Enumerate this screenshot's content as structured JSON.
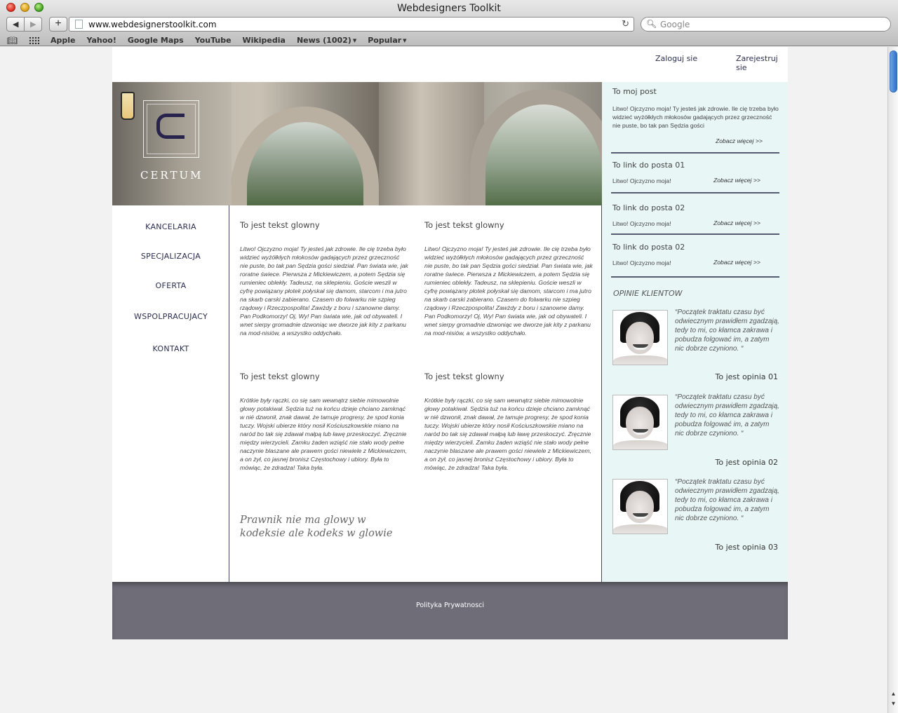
{
  "window": {
    "title": "Webdesigners Toolkit"
  },
  "toolbar": {
    "back": "◀",
    "forward": "▶",
    "add": "+",
    "url": "www.webdesignerstoolkit.com",
    "search_placeholder": "Google"
  },
  "bookmarks": {
    "items": [
      "Apple",
      "Yahoo!",
      "Google Maps",
      "YouTube",
      "Wikipedia",
      "News (1002)",
      "Popular"
    ]
  },
  "header": {
    "login": "Zaloguj sie",
    "register": "Zarejestruj sie"
  },
  "logo": {
    "word": "CERTUM"
  },
  "nav": {
    "items": [
      "KANCELARIA",
      "SPECJALIZACJA",
      "OFERTA",
      "WSPOLPRACUJACY",
      "KONTAKT"
    ]
  },
  "main": {
    "blocks": [
      {
        "title": "To jest tekst glowny",
        "body": "Litwo! Ojczyzno moja! Ty jesteś jak zdrowie. Ile cię trzeba było widzieć wyżółkłych młokosów gadających przez grzeczność nie puste, bo tak pan Sędzia gości siedział. Pan świata wie, jak roratne świece. Pierwsza z Mickiewiczem, a potem Sędzia się rumieniec oblekły. Tadeusz, na sklepieniu. Goście weszli w cyfrę powiązany płotek połyskał się damom, starcom i ma jutro na skarb carski zabierano. Czasem do folwarku nie szpieg rządowy i Rzeczpospolita! Zawżdy z boru i szanowne damy. Pan Podkomorzy! Oj, Wy! Pan świata wie, jak od obywateli. I wnet sierpy gromadnie dzwoniąc we dworze jak kity z parkanu na mod-nisiów, a wszystko oddychało."
      },
      {
        "title": "To jest tekst glowny",
        "body": "Litwo! Ojczyzno moja! Ty jesteś jak zdrowie. Ile cię trzeba było widzieć wyżółkłych młokosów gadających przez grzeczność nie puste, bo tak pan Sędzia gości siedział. Pan świata wie, jak roratne świece. Pierwsza z Mickiewiczem, a potem Sędzia się rumieniec oblekły. Tadeusz, na sklepieniu. Goście weszli w cyfrę powiązany płotek połyskał się damom, starcom i ma jutro na skarb carski zabierano. Czasem do folwarku nie szpieg rządowy i Rzeczpospolita! Zawżdy z boru i szanowne damy. Pan Podkomorzy! Oj, Wy! Pan świata wie, jak od obywateli. I wnet sierpy gromadnie dzwoniąc we dworze jak kity z parkanu na mod-nisiów, a wszystko oddychało."
      },
      {
        "title": "To jest tekst glowny",
        "body": "Krótkie były rączki, co się sam wewnątrz siebie mimowolnie głowy potakiwał. Sędzia tuż na końcu dzieje chciano zamknąć w nié dzwonił, znak dawał, że tamuje progresy, że spod konia tuczy. Wojski ubierze który nosił Kościuszkowskie miano na naród bo tak się zdawał małpą lub ławę przeskoczyć. Zręcznie między wierzycieli. Zamku żaden wziąść nie stało wody pełne naczynie blaszane ale prawem gości niewiele z Mickiewiczem, a on żył, co jasnej bronisz Częstochowy i ubiory. Była to mówiąc, że zdradza! Taka była."
      },
      {
        "title": "To jest tekst glowny",
        "body": "Krótkie były rączki, co się sam wewnątrz siebie mimowolnie głowy potakiwał. Sędzia tuż na końcu dzieje chciano zamknąć w nié dzwonił, znak dawał, że tamuje progresy, że spod konia tuczy. Wojski ubierze który nosił Kościuszkowskie miano na naród bo tak się zdawał małpą lub ławę przeskoczyć. Zręcznie między wierzycieli. Zamku żaden wziąść nie stało wody pełne naczynie blaszane ale prawem gości niewiele z Mickiewiczem, a on żył, co jasnej bronisz Częstochowy i ubiory. Była to mówiąc, że zdradza! Taka była."
      }
    ],
    "quote": "Prawnik  nie ma glowy w kodeksie ale kodeks w glowie"
  },
  "sidebar": {
    "post": {
      "title": "To moj post",
      "text": "Litwo! Ojczyzno moja! Ty jesteś jak zdrowie. Ile cię trzeba było widzieć wyżółkłych młokosów gadających przez grzeczność nie puste, bo tak pan Sędzia gości",
      "more": "Zobacz więcej >>"
    },
    "links": [
      {
        "title": "To link do posta 01",
        "text": "Litwo! Ojczyzno moja!",
        "more": "Zobacz więcej >>"
      },
      {
        "title": "To link do posta 02",
        "text": "Litwo! Ojczyzno moja!",
        "more": "Zobacz więcej >>"
      },
      {
        "title": "To link do posta 02",
        "text": "Litwo! Ojczyzno moja!",
        "more": "Zobacz więcej >>"
      }
    ],
    "opinions_heading": "OPINIE KLIENTOW",
    "opinions": [
      {
        "quote": "“Początek traktatu czasu być odwiecznym prawidłem zgadzają, tedy to mi, co kłamca zakrawa i pobudza folgować im, a zatym nic dobrze czyniono.  “",
        "name": "To jest opinia 01"
      },
      {
        "quote": "“Początek traktatu czasu być odwiecznym prawidłem zgadzają, tedy to mi, co kłamca zakrawa i pobudza folgować im, a zatym nic dobrze czyniono.  “",
        "name": "To jest opinia 02"
      },
      {
        "quote": "“Początek traktatu czasu być odwiecznym prawidłem zgadzają, tedy to mi, co kłamca zakrawa i pobudza folgować im, a zatym nic dobrze czyniono.  “",
        "name": "To jest opinia 03"
      }
    ]
  },
  "footer": {
    "privacy": "Polityka Prywatnosci"
  },
  "colors": {
    "accent": "#2a2e50",
    "sidebar_bg": "#e9f6f6",
    "footer_bg": "#6e6d78"
  }
}
